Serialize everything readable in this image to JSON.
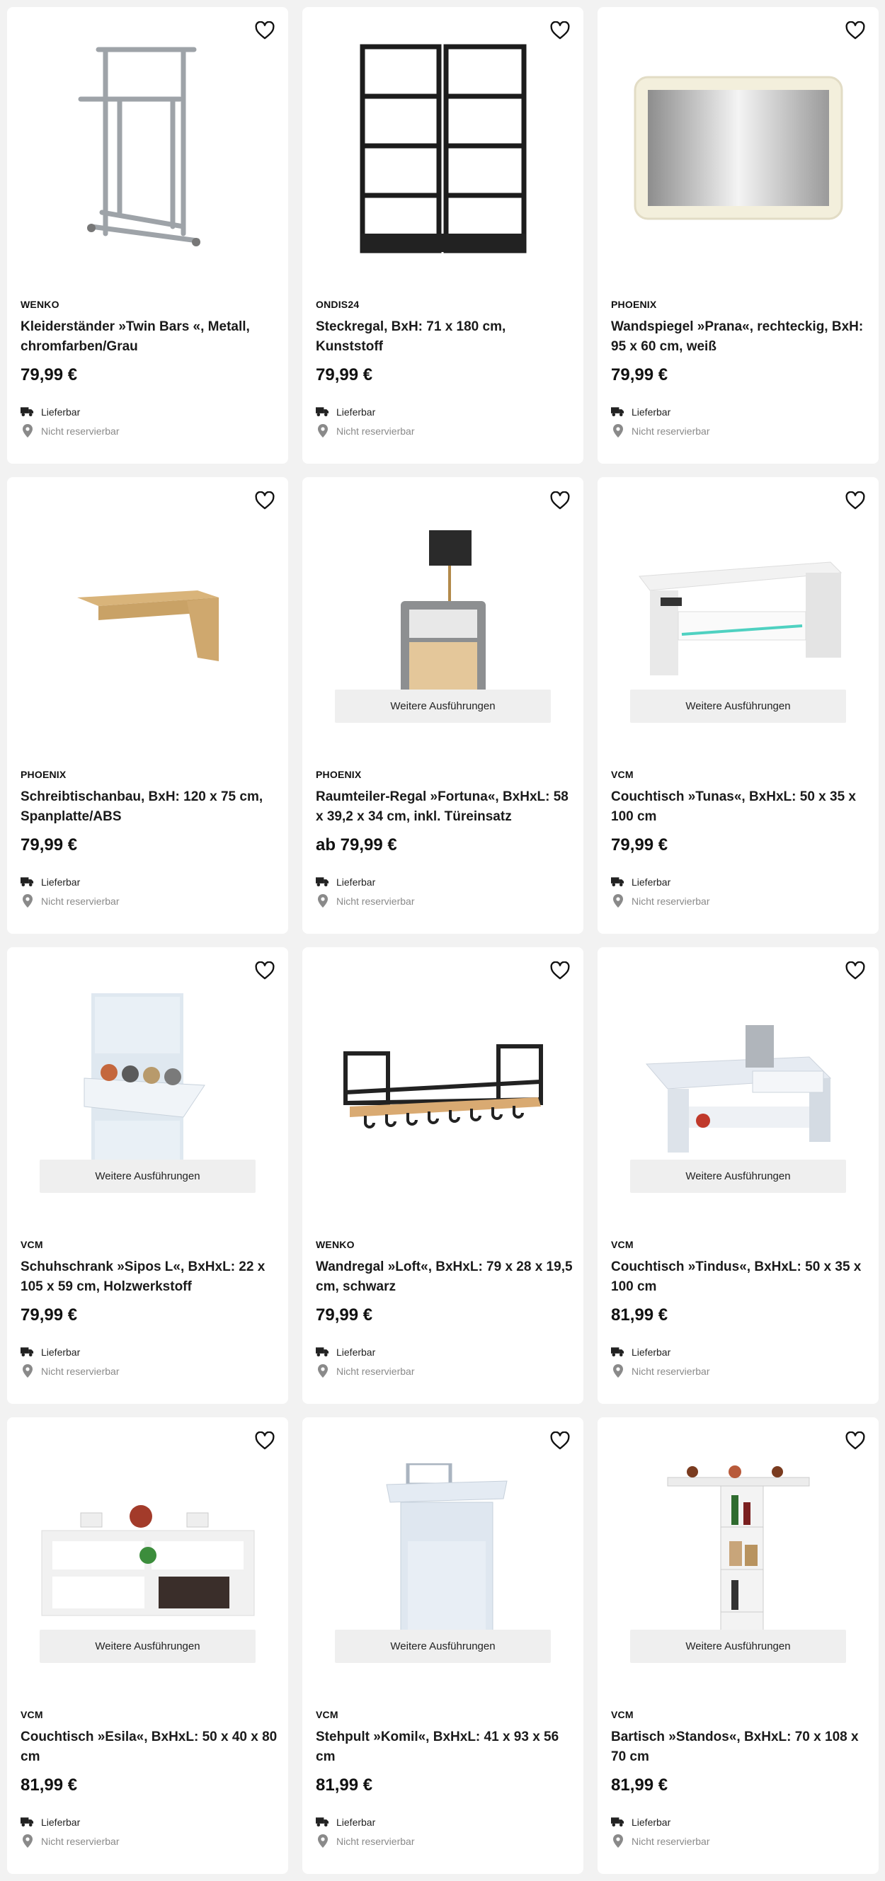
{
  "common": {
    "availability": "Lieferbar",
    "reservation": "Nicht reservierbar",
    "variants_label": "Weitere Ausführungen"
  },
  "products": [
    {
      "brand": "WENKO",
      "title": "Kleiderständer »Twin Bars «, Metall, chromfarben/Grau",
      "price": "79,99 €",
      "image": "garment-rack-image",
      "variants": false
    },
    {
      "brand": "ONDIS24",
      "title": "Steckregal, BxH: 71 x 180 cm, Kunststoff",
      "price": "79,99 €",
      "image": "shelving-unit-image",
      "variants": false
    },
    {
      "brand": "PHOENIX",
      "title": "Wandspiegel »Prana«, rechteckig, BxH: 95 x 60 cm, weiß",
      "price": "79,99 €",
      "image": "wall-mirror-image",
      "variants": false
    },
    {
      "brand": "PHOENIX",
      "title": "Schreibtischanbau, BxH: 120 x 75 cm, Spanplatte/ABS",
      "price": "79,99 €",
      "image": "desk-extension-image",
      "variants": false
    },
    {
      "brand": "PHOENIX",
      "title": "Raumteiler-Regal »Fortuna«, BxHxL: 58 x 39,2 x 34 cm, inkl. Türeinsatz",
      "price": "ab 79,99 €",
      "image": "room-divider-shelf-image",
      "variants": true
    },
    {
      "brand": "VCM",
      "title": "Couchtisch »Tunas«, BxHxL: 50 x 35 x 100 cm",
      "price": "79,99 €",
      "image": "coffee-table-tunas-image",
      "variants": true
    },
    {
      "brand": "VCM",
      "title": "Schuhschrank »Sipos L«, BxHxL: 22 x 105 x 59 cm, Holzwerkstoff",
      "price": "79,99 €",
      "image": "shoe-cabinet-image",
      "variants": true
    },
    {
      "brand": "WENKO",
      "title": "Wandregal »Loft«, BxHxL: 79 x 28 x 19,5 cm, schwarz",
      "price": "79,99 €",
      "image": "wall-shelf-loft-image",
      "variants": false
    },
    {
      "brand": "VCM",
      "title": "Couchtisch »Tindus«, BxHxL: 50 x 35 x 100 cm",
      "price": "81,99 €",
      "image": "coffee-table-tindus-image",
      "variants": true
    },
    {
      "brand": "VCM",
      "title": "Couchtisch »Esila«, BxHxL: 50 x 40 x 80 cm",
      "price": "81,99 €",
      "image": "coffee-table-esila-image",
      "variants": true
    },
    {
      "brand": "VCM",
      "title": "Stehpult »Komil«, BxHxL: 41 x 93 x 56 cm",
      "price": "81,99 €",
      "image": "standing-desk-image",
      "variants": true
    },
    {
      "brand": "VCM",
      "title": "Bartisch »Standos«, BxHxL: 70 x 108 x 70 cm",
      "price": "81,99 €",
      "image": "bar-table-image",
      "variants": true
    }
  ]
}
